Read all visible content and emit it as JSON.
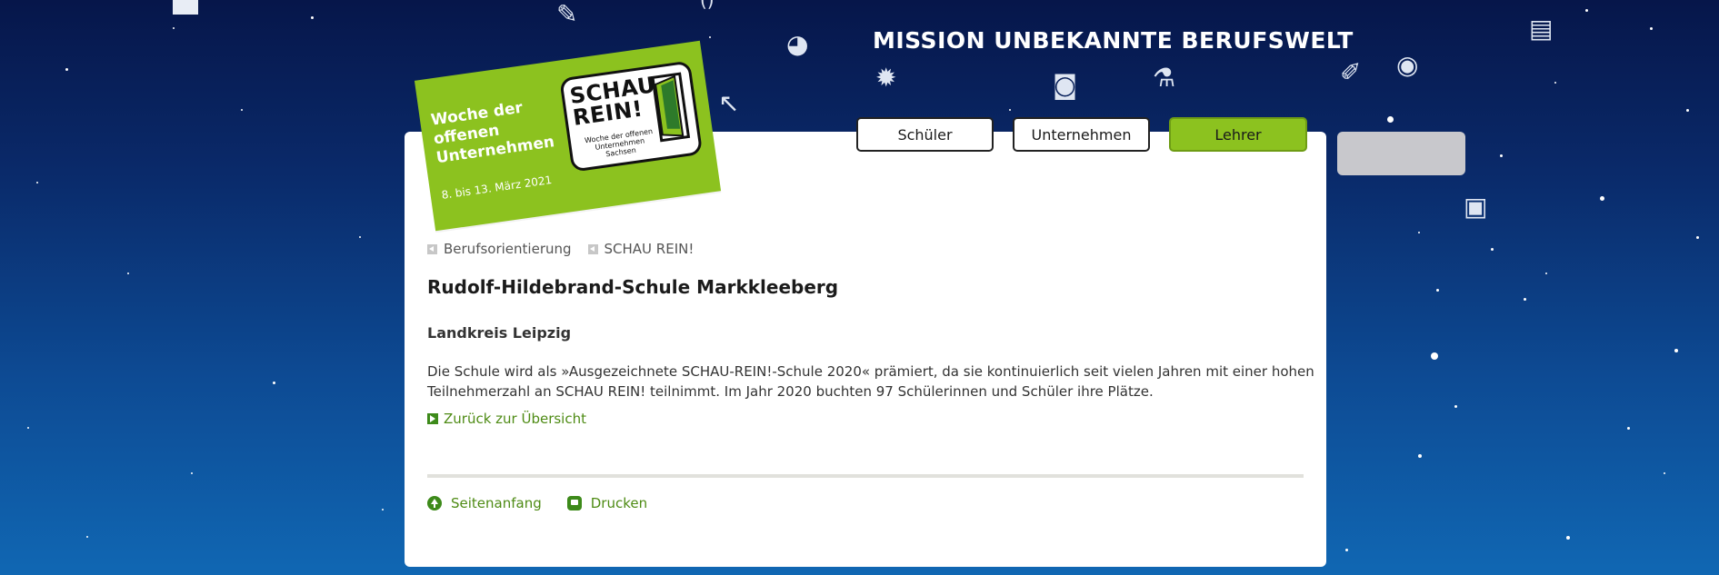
{
  "header": {
    "mission_title": "MISSION UNBEKANNTE BERUFSWELT"
  },
  "badge": {
    "tagline": "Woche der offenen Unternehmen",
    "date": "8. bis 13. März 2021",
    "logo_title": "SCHAU REIN!",
    "logo_subtitle": "Woche der offenen Unternehmen Sachsen",
    "color": "#8cc21f"
  },
  "tabs": [
    {
      "label": "Schüler",
      "active": false
    },
    {
      "label": "Unternehmen",
      "active": false
    },
    {
      "label": "Lehrer",
      "active": true
    }
  ],
  "breadcrumb": [
    {
      "label": "Berufsorientierung"
    },
    {
      "label": "SCHAU REIN!"
    }
  ],
  "main": {
    "title": "Rudolf-Hildebrand-Schule Markkleeberg",
    "subtitle": "Landkreis Leipzig",
    "description": "Die Schule wird als »Ausgezeichnete SCHAU-REIN!-Schule 2020« prämiert, da sie kontinuierlich seit vielen Jahren mit einer hohen Teilnehmerzahl an SCHAU REIN! teilnimmt. Im Jahr 2020 buchten 97 Schülerinnen und Schüler ihre Plätze.",
    "back_link": "Zurück zur Übersicht"
  },
  "footer": {
    "top_link": "Seitenanfang",
    "print_link": "Drucken"
  },
  "colors": {
    "accent": "#8cc21f",
    "link": "#4e8b14",
    "background_top": "#06164a",
    "background_bottom": "#1067b3"
  }
}
